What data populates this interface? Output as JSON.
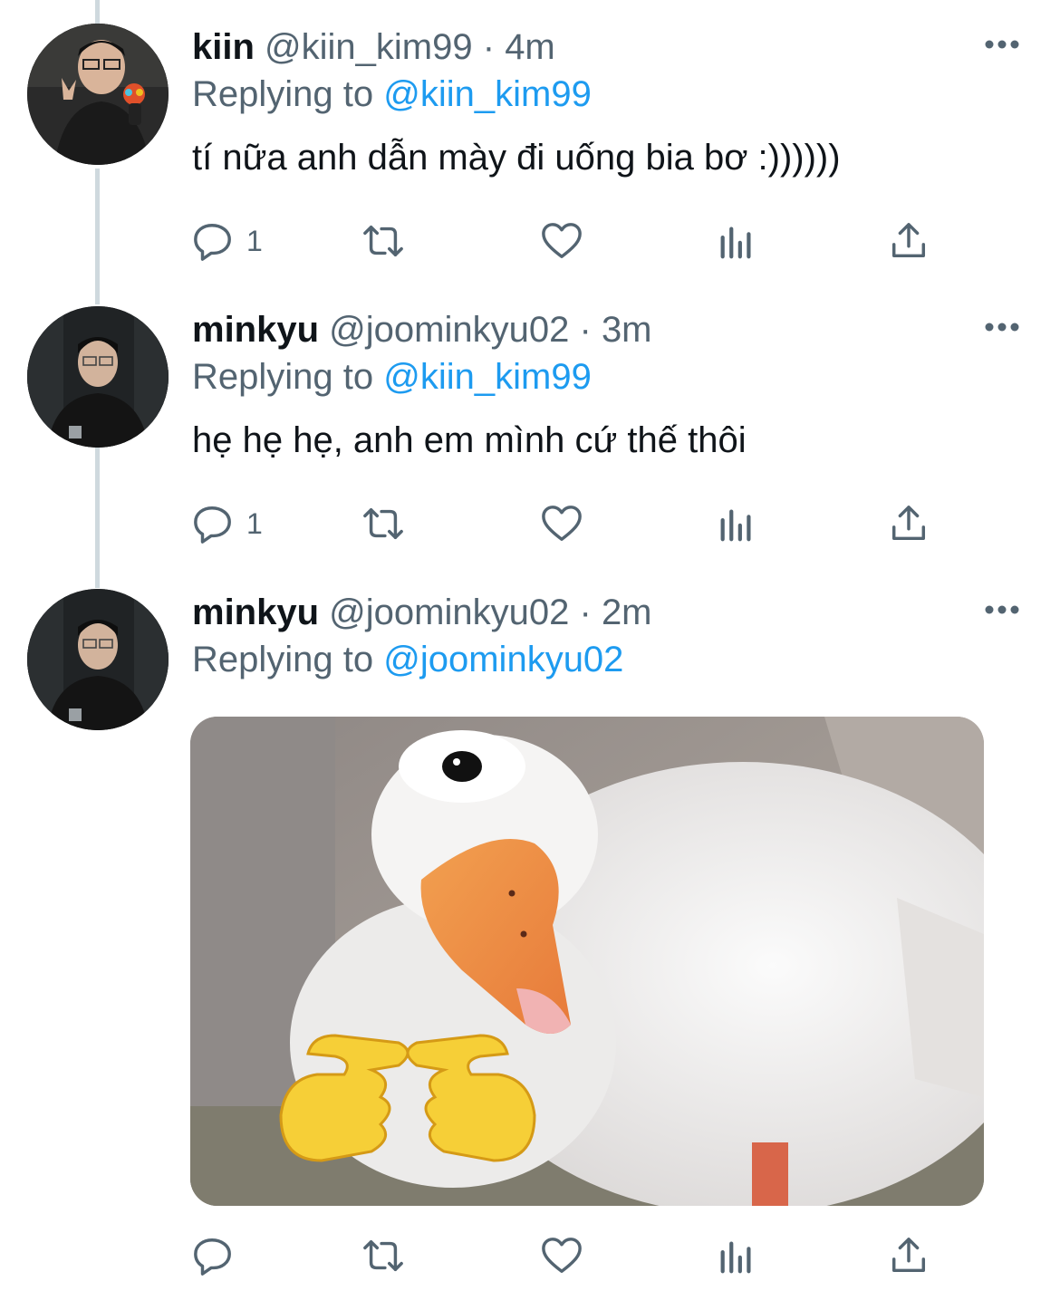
{
  "tweets": [
    {
      "name": "kiin",
      "handle": "@kiin_kim99",
      "dot": "·",
      "time": "4m",
      "replying_prefix": "Replying to",
      "replying_to": "@kiin_kim99",
      "text": "tí nữa anh dẫn mày đi uống bia bơ :))))))",
      "reply_count": "1",
      "avatar_icon": "person-avatar-icon"
    },
    {
      "name": "minkyu",
      "handle": "@joominkyu02",
      "dot": "·",
      "time": "3m",
      "replying_prefix": "Replying to",
      "replying_to": "@kiin_kim99",
      "text": "hẹ hẹ hẹ, anh em mình cứ thế thôi",
      "reply_count": "1",
      "avatar_icon": "person-avatar-icon"
    },
    {
      "name": "minkyu",
      "handle": "@joominkyu02",
      "dot": "·",
      "time": "2m",
      "replying_prefix": "Replying to",
      "replying_to": "@joominkyu02",
      "reply_count": "",
      "media_icon": "duck-photo"
    }
  ],
  "icons": {
    "reply": "reply-icon",
    "retweet": "retweet-icon",
    "like": "heart-icon",
    "views": "analytics-icon",
    "share": "share-icon",
    "more": "more-icon"
  },
  "colors": {
    "link": "#1d9bf0",
    "muted": "#536471",
    "text": "#0f1419",
    "thread_line": "#cfd9de"
  }
}
